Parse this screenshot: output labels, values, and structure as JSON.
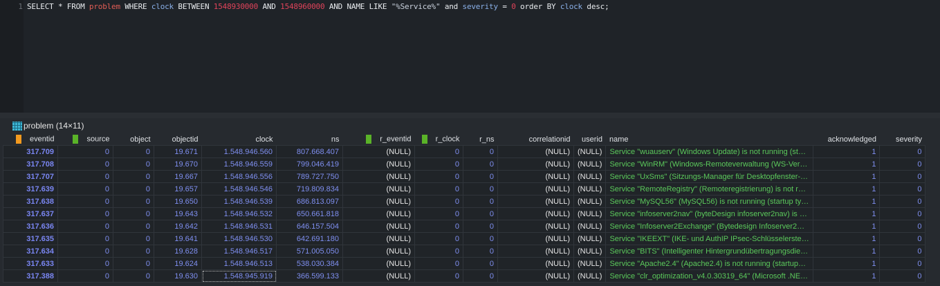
{
  "editor": {
    "line_number": "1",
    "query_parts": [
      "SELECT * FROM ",
      "problem",
      " WHERE ",
      "clock",
      " BETWEEN ",
      "1548930000",
      " AND ",
      "1548960000",
      " AND NAME LIKE ",
      "\"%Service%\"",
      " and ",
      "severity",
      " = ",
      "0",
      " order BY ",
      "clock",
      " desc;"
    ]
  },
  "result": {
    "title": "problem (14×11)",
    "columns": [
      "eventid",
      "source",
      "object",
      "objectid",
      "clock",
      "ns",
      "r_eventid",
      "r_clock",
      "r_ns",
      "correlationid",
      "userid",
      "name",
      "acknowledged",
      "severity"
    ],
    "rows": [
      [
        "317.709",
        "0",
        "0",
        "19.671",
        "1.548.946.560",
        "807.668.407",
        "(NULL)",
        "0",
        "0",
        "(NULL)",
        "(NULL)",
        "Service \"wuauserv\" (Windows Update) is not running (st…",
        "1",
        "0"
      ],
      [
        "317.708",
        "0",
        "0",
        "19.670",
        "1.548.946.559",
        "799.046.419",
        "(NULL)",
        "0",
        "0",
        "(NULL)",
        "(NULL)",
        "Service \"WinRM\" (Windows-Remoteverwaltung (WS-Ver…",
        "1",
        "0"
      ],
      [
        "317.707",
        "0",
        "0",
        "19.667",
        "1.548.946.556",
        "789.727.750",
        "(NULL)",
        "0",
        "0",
        "(NULL)",
        "(NULL)",
        "Service \"UxSms\" (Sitzungs-Manager für Desktopfenster-…",
        "1",
        "0"
      ],
      [
        "317.639",
        "0",
        "0",
        "19.657",
        "1.548.946.546",
        "719.809.834",
        "(NULL)",
        "0",
        "0",
        "(NULL)",
        "(NULL)",
        "Service \"RemoteRegistry\" (Remoteregistrierung) is not r…",
        "1",
        "0"
      ],
      [
        "317.638",
        "0",
        "0",
        "19.650",
        "1.548.946.539",
        "686.813.097",
        "(NULL)",
        "0",
        "0",
        "(NULL)",
        "(NULL)",
        "Service \"MySQL56\" (MySQL56) is not running (startup ty…",
        "1",
        "0"
      ],
      [
        "317.637",
        "0",
        "0",
        "19.643",
        "1.548.946.532",
        "650.661.818",
        "(NULL)",
        "0",
        "0",
        "(NULL)",
        "(NULL)",
        "Service \"infoserver2nav\" (byteDesign infoserver2nav) is …",
        "1",
        "0"
      ],
      [
        "317.636",
        "0",
        "0",
        "19.642",
        "1.548.946.531",
        "646.157.504",
        "(NULL)",
        "0",
        "0",
        "(NULL)",
        "(NULL)",
        "Service \"Infoserver2Exchange\" (Bytedesign Infoserver2…",
        "1",
        "0"
      ],
      [
        "317.635",
        "0",
        "0",
        "19.641",
        "1.548.946.530",
        "642.691.180",
        "(NULL)",
        "0",
        "0",
        "(NULL)",
        "(NULL)",
        "Service \"IKEEXT\" (IKE- und AuthIP IPsec-Schlüsselerstell…",
        "1",
        "0"
      ],
      [
        "317.634",
        "0",
        "0",
        "19.628",
        "1.548.946.517",
        "571.005.050",
        "(NULL)",
        "0",
        "0",
        "(NULL)",
        "(NULL)",
        "Service \"BITS\" (Intelligenter Hintergrundübertragungsdie…",
        "1",
        "0"
      ],
      [
        "317.633",
        "0",
        "0",
        "19.624",
        "1.548.946.513",
        "538.030.384",
        "(NULL)",
        "0",
        "0",
        "(NULL)",
        "(NULL)",
        "Service \"Apache2.4\" (Apache2.4) is not running (startup…",
        "1",
        "0"
      ],
      [
        "317.388",
        "0",
        "0",
        "19.630",
        "1.548.945.919",
        "366.599.133",
        "(NULL)",
        "0",
        "0",
        "(NULL)",
        "(NULL)",
        "Service \"clr_optimization_v4.0.30319_64\" (Microsoft .NE…",
        "1",
        "0"
      ]
    ]
  }
}
